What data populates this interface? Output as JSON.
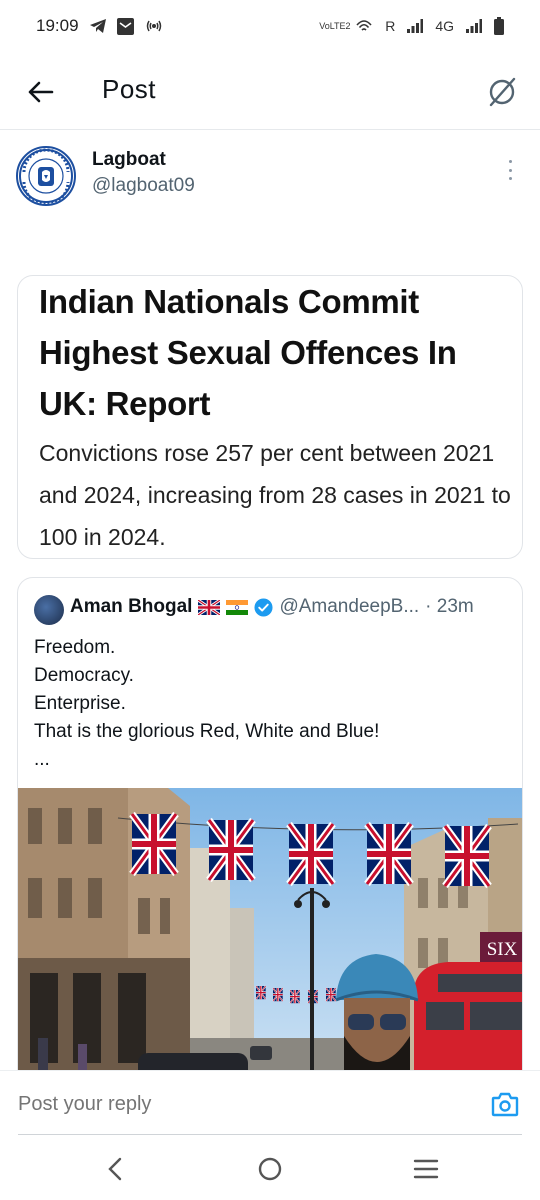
{
  "status_bar": {
    "time": "19:09",
    "network_label": "4G",
    "volte_label": "VoLTE2",
    "roaming_label": "R"
  },
  "header": {
    "title": "Post",
    "back_icon": "arrow-left-icon",
    "action_icon": "grok-icon"
  },
  "author": {
    "name": "Lagboat",
    "handle": "@lagboat09",
    "avatar": "millwall-crest",
    "avatar_text": "MILLWALL FOOTBALL CLUB"
  },
  "article": {
    "headline": "Indian Nationals Commit Highest Sexual Offences In UK: Report",
    "summary": "Convictions rose 257 per cent between 2021 and 2024, increasing from 28 cases in 2021 to 100 in 2024."
  },
  "quote": {
    "name": "Aman Bhogal",
    "handle": "@AmandeepB...",
    "time": "· 23m",
    "lines": [
      "Freedom.",
      "Democracy.",
      "Enterprise.",
      "That is the glorious Red, White and Blue!",
      "..."
    ],
    "photo_sign_text": "SIX"
  },
  "reply": {
    "placeholder": "Post your reply"
  },
  "colors": {
    "accent": "#1d9bf0",
    "text": "#0f1419",
    "muted": "#536471",
    "border": "#e1e4e8"
  }
}
